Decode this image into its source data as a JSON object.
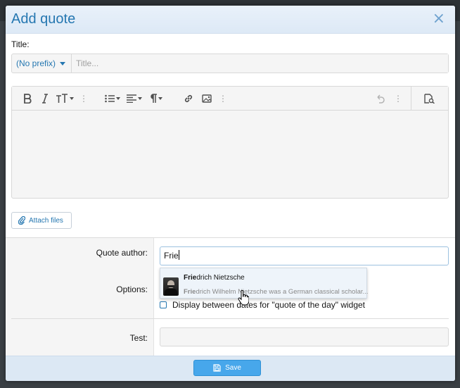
{
  "dialog": {
    "title": "Add quote",
    "close_label": "×"
  },
  "form": {
    "title_label": "Title:",
    "prefix_value": "(No prefix)",
    "title_placeholder": "Title...",
    "attach_label": "Attach files",
    "quote_author_label": "Quote author:",
    "quote_author_value": "Frie",
    "options_label": "Options:",
    "option_checkbox_label": "Display between dates for \"quote of the day\" widget",
    "test_label": "Test:",
    "save_label": "Save"
  },
  "editor_toolbar": {
    "icons": [
      "bold-icon",
      "italic-icon",
      "text-size-icon",
      "more-icon",
      "list-icon",
      "align-icon",
      "paragraph-icon",
      "link-icon",
      "image-icon",
      "more-icon",
      "undo-icon",
      "more-icon",
      "preview-icon"
    ]
  },
  "autocomplete": {
    "match": "Frie",
    "name_rest": "drich Nietzsche",
    "desc_rest": "drich Wilhelm Nietzsche was a German classical scholar..."
  },
  "colors": {
    "accent": "#2577b1",
    "header_bg": "#e4eef8",
    "save_button": "#47a7eb"
  }
}
